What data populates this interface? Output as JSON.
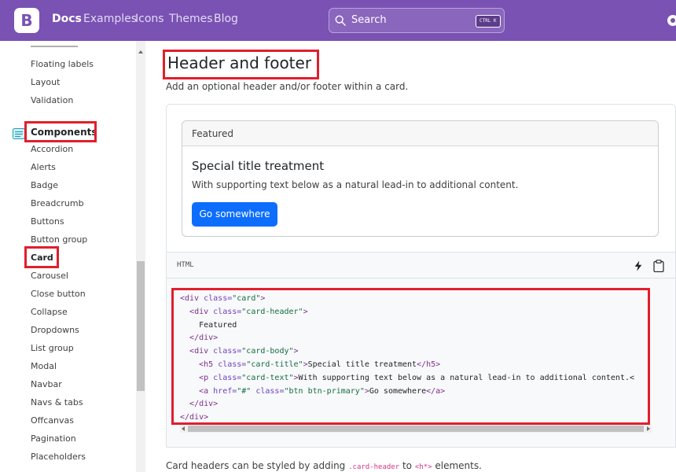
{
  "navbar": {
    "logo_letter": "B",
    "links": [
      "Docs",
      "Examples",
      "Icons",
      "Themes",
      "Blog"
    ],
    "search": {
      "placeholder": "Search",
      "shortcut": "CTRL K"
    }
  },
  "sidebar": {
    "forms_items": [
      "Floating labels",
      "Layout",
      "Validation"
    ],
    "section_title": "Components",
    "component_items": [
      "Accordion",
      "Alerts",
      "Badge",
      "Breadcrumb",
      "Buttons",
      "Button group",
      "Card",
      "Carousel",
      "Close button",
      "Collapse",
      "Dropdowns",
      "List group",
      "Modal",
      "Navbar",
      "Navs & tabs",
      "Offcanvas",
      "Pagination",
      "Placeholders"
    ],
    "active_item": "Card"
  },
  "main": {
    "title": "Header and footer",
    "lead": "Add an optional header and/or footer within a card.",
    "example_card": {
      "header": "Featured",
      "title": "Special title treatment",
      "text": "With supporting text below as a natural lead-in to additional content.",
      "button": "Go somewhere"
    },
    "code": {
      "language": "HTML",
      "lines": [
        [
          {
            "t": "tag",
            "v": "<div "
          },
          {
            "t": "attr",
            "v": "class="
          },
          {
            "t": "str",
            "v": "\"card\""
          },
          {
            "t": "tag",
            "v": ">"
          }
        ],
        [
          {
            "t": "txt",
            "v": "  "
          },
          {
            "t": "tag",
            "v": "<div "
          },
          {
            "t": "attr",
            "v": "class="
          },
          {
            "t": "str",
            "v": "\"card-header\""
          },
          {
            "t": "tag",
            "v": ">"
          }
        ],
        [
          {
            "t": "txt",
            "v": "    Featured"
          }
        ],
        [
          {
            "t": "txt",
            "v": "  "
          },
          {
            "t": "tag",
            "v": "</div>"
          }
        ],
        [
          {
            "t": "txt",
            "v": "  "
          },
          {
            "t": "tag",
            "v": "<div "
          },
          {
            "t": "attr",
            "v": "class="
          },
          {
            "t": "str",
            "v": "\"card-body\""
          },
          {
            "t": "tag",
            "v": ">"
          }
        ],
        [
          {
            "t": "txt",
            "v": "    "
          },
          {
            "t": "tag",
            "v": "<h5 "
          },
          {
            "t": "attr",
            "v": "class="
          },
          {
            "t": "str",
            "v": "\"card-title\""
          },
          {
            "t": "tag",
            "v": ">"
          },
          {
            "t": "txt",
            "v": "Special title treatment"
          },
          {
            "t": "tag",
            "v": "</h5>"
          }
        ],
        [
          {
            "t": "txt",
            "v": "    "
          },
          {
            "t": "tag",
            "v": "<p "
          },
          {
            "t": "attr",
            "v": "class="
          },
          {
            "t": "str",
            "v": "\"card-text\""
          },
          {
            "t": "tag",
            "v": ">"
          },
          {
            "t": "txt",
            "v": "With supporting text below as a natural lead-in to additional content.<"
          }
        ],
        [
          {
            "t": "txt",
            "v": "    "
          },
          {
            "t": "tag",
            "v": "<a "
          },
          {
            "t": "attr",
            "v": "href="
          },
          {
            "t": "str",
            "v": "\"#\""
          },
          {
            "t": "attr",
            "v": " class="
          },
          {
            "t": "str",
            "v": "\"btn btn-primary\""
          },
          {
            "t": "tag",
            "v": ">"
          },
          {
            "t": "txt",
            "v": "Go somewhere"
          },
          {
            "t": "tag",
            "v": "</a>"
          }
        ],
        [
          {
            "t": "txt",
            "v": "  "
          },
          {
            "t": "tag",
            "v": "</div>"
          }
        ],
        [
          {
            "t": "tag",
            "v": "</div>"
          }
        ]
      ]
    },
    "footnote": {
      "before": "Card headers can be styled by adding ",
      "code1": ".card-header",
      "middle": " to ",
      "code2": "<h*>",
      "after": " elements."
    }
  },
  "colors": {
    "brand": "#7952b3",
    "primary": "#0d6efd",
    "highlight": "#e01f2d"
  }
}
